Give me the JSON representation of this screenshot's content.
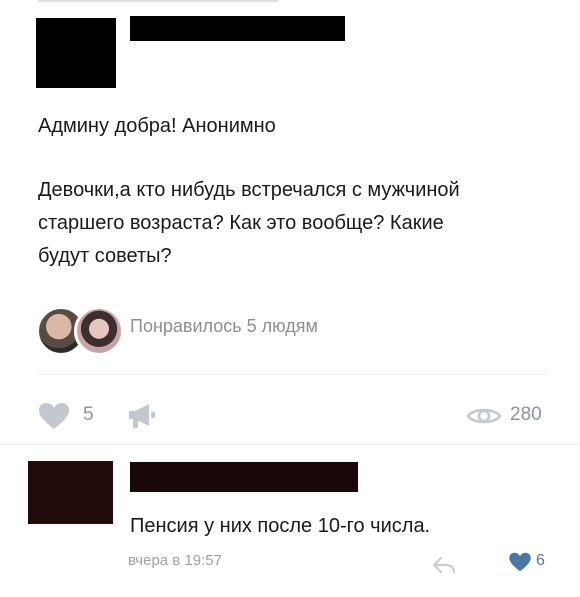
{
  "post": {
    "line1": "Админу добра! Анонимно",
    "line2": "Девочки,а кто нибудь встречался с мужчиной",
    "line3": "старшего возраста? Как это вообще? Какие",
    "line4": "будут советы?",
    "likes_text": "Понравилось 5 людям"
  },
  "actions": {
    "likes_count": "5",
    "views_count": "280",
    "icons": [
      "heart-icon",
      "megaphone-icon",
      "eye-icon"
    ]
  },
  "comment": {
    "text": "Пенсия у них после 10-го числа.",
    "time": "вчера в 19:57",
    "likes_count": "6",
    "icons": [
      "reply-icon",
      "heart-icon"
    ],
    "accent_color": "#4a76a8"
  }
}
